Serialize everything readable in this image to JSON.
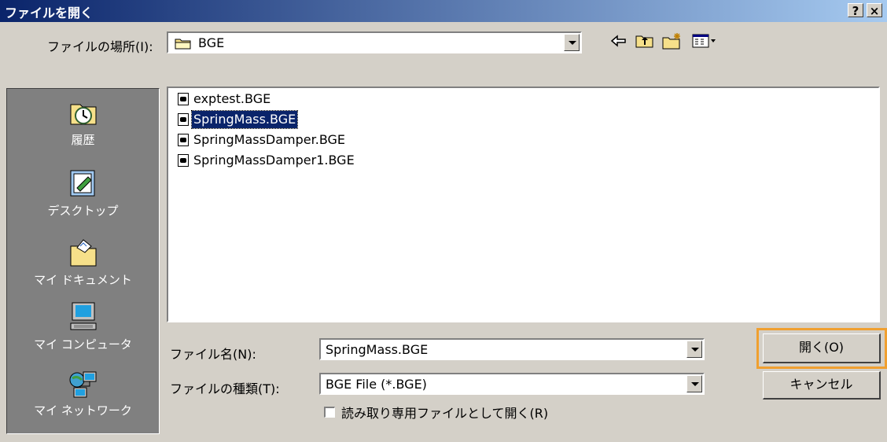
{
  "window": {
    "title": "ファイルを開く",
    "help_label": "?",
    "close_label": "×"
  },
  "location": {
    "label": "ファイルの場所(I):",
    "current": "BGE"
  },
  "toolbar": {
    "icons": [
      "back-icon",
      "up-folder-icon",
      "new-folder-icon",
      "view-menu-icon"
    ]
  },
  "places": [
    {
      "label": "履歴",
      "icon": "history-icon"
    },
    {
      "label": "デスクトップ",
      "icon": "desktop-icon"
    },
    {
      "label": "マイ ドキュメント",
      "icon": "my-documents-icon"
    },
    {
      "label": "マイ コンピュータ",
      "icon": "my-computer-icon"
    },
    {
      "label": "マイ ネットワーク",
      "icon": "my-network-icon"
    }
  ],
  "files": [
    {
      "name": "exptest.BGE",
      "selected": false
    },
    {
      "name": "SpringMass.BGE",
      "selected": true
    },
    {
      "name": "SpringMassDamper.BGE",
      "selected": false
    },
    {
      "name": "SpringMassDamper1.BGE",
      "selected": false
    }
  ],
  "filename": {
    "label": "ファイル名(N):",
    "value": "SpringMass.BGE"
  },
  "filetype": {
    "label": "ファイルの種類(T):",
    "value": "BGE File (*.BGE)"
  },
  "readonly": {
    "label": "読み取り専用ファイルとして開く(R)",
    "checked": false
  },
  "buttons": {
    "open": "開く(O)",
    "cancel": "キャンセル"
  },
  "colors": {
    "title_gradient_start": "#0a246a",
    "title_gradient_end": "#a6caf0",
    "selection": "#0a246a",
    "highlight_frame": "#f0a030"
  }
}
